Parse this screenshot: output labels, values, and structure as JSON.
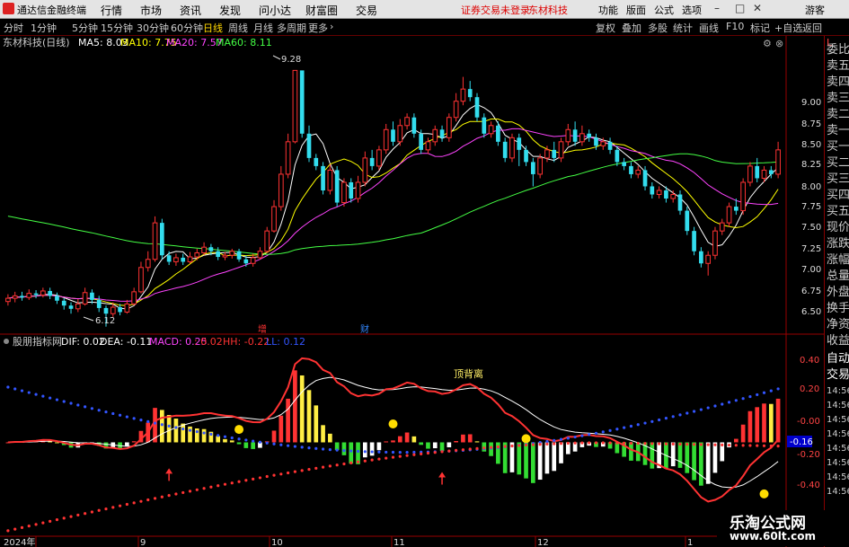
{
  "menubar": {
    "title": "通达信金融终端",
    "menus": [
      "行情",
      "市场",
      "资讯",
      "发现",
      "问小达",
      "财富圈",
      "交易"
    ],
    "notice": "证券交易未登录",
    "stock": "东材科技",
    "right": [
      "功能",
      "版面",
      "公式",
      "选项"
    ],
    "user": "游客"
  },
  "toolbar": {
    "periods": [
      "分时",
      "1分钟",
      "5分钟",
      "15分钟",
      "30分钟",
      "60分钟",
      "日线",
      "周线",
      "月线",
      "多周期",
      "更多"
    ],
    "active": "日线",
    "right": [
      "复权",
      "叠加",
      "多股",
      "统计",
      "画线",
      "F10",
      "标记",
      "+自选",
      "返回"
    ]
  },
  "price_panel": {
    "title": "东材科技(日线)",
    "ma_labels": [
      {
        "label": "MA5: 8.03",
        "color": "#ffffff"
      },
      {
        "label": "MA10: 7.75",
        "color": "#ffff00"
      },
      {
        "label": "MA20: 7.57",
        "color": "#ff44ff"
      },
      {
        "label": "MA60: 8.11",
        "color": "#44ff44"
      }
    ],
    "high_label": "9.28",
    "low_label": "6.12",
    "marks": [
      "增",
      "财"
    ]
  },
  "indicator_panel": {
    "title": "股朋指标网",
    "items": [
      {
        "label": "DIF: 0.02",
        "color": "#ffffff"
      },
      {
        "label": "DEA: -0.11",
        "color": "#ffffff"
      },
      {
        "label": "MACD: 0.25",
        "color": "#ff44ff"
      },
      {
        "label": ": 0.02",
        "color": "#ff3333"
      },
      {
        "label": "HH: -0.22",
        "color": "#ff3333"
      },
      {
        "label": "LL: 0.12",
        "color": "#3355ff"
      }
    ],
    "annotation": "顶背离",
    "current_value": "-0.16"
  },
  "x_axis": [
    "2024年",
    "9",
    "10",
    "11",
    "12",
    "1"
  ],
  "side_panel": {
    "label": "L",
    "items": [
      "委比",
      "卖五",
      "卖四",
      "卖三",
      "卖二",
      "卖一",
      "买一",
      "买二",
      "买三",
      "买四",
      "买五",
      "现价",
      "涨跌",
      "涨幅",
      "总量",
      "外盘",
      "换手",
      "净资",
      "收益",
      "自动",
      "交易"
    ],
    "ticks": [
      "14:56",
      "14:56",
      "14:56",
      "14:56",
      "14:56",
      "14:56",
      "14:56",
      "14:56"
    ]
  },
  "price_axis": [
    "9.00",
    "8.75",
    "8.50",
    "8.25",
    "8.00",
    "7.75",
    "7.50",
    "7.25",
    "7.00",
    "6.75",
    "6.50"
  ],
  "indicator_axis": [
    "0.40",
    "0.20",
    "-0.00",
    "-0.20",
    "-0.40"
  ],
  "watermark": {
    "line1": "乐淘公式网",
    "line2": "www.60lt.com"
  },
  "chart_data": {
    "type": "candlestick",
    "title": "东材科技(日线)",
    "candles": [
      [
        6.43,
        6.47,
        6.38,
        6.52
      ],
      [
        6.47,
        6.5,
        6.42,
        6.55
      ],
      [
        6.5,
        6.48,
        6.44,
        6.55
      ],
      [
        6.48,
        6.53,
        6.45,
        6.58
      ],
      [
        6.53,
        6.51,
        6.47,
        6.57
      ],
      [
        6.51,
        6.56,
        6.48,
        6.6
      ],
      [
        6.56,
        6.5,
        6.46,
        6.6
      ],
      [
        6.5,
        6.44,
        6.4,
        6.54
      ],
      [
        6.44,
        6.38,
        6.33,
        6.47
      ],
      [
        6.38,
        6.34,
        6.28,
        6.42
      ],
      [
        6.34,
        6.4,
        6.3,
        6.46
      ],
      [
        6.4,
        6.54,
        6.38,
        6.6
      ],
      [
        6.54,
        6.45,
        6.4,
        6.58
      ],
      [
        6.45,
        6.35,
        6.3,
        6.5
      ],
      [
        6.35,
        6.28,
        6.12,
        6.38
      ],
      [
        6.28,
        6.36,
        6.24,
        6.42
      ],
      [
        6.36,
        6.3,
        6.26,
        6.4
      ],
      [
        6.3,
        6.4,
        6.28,
        6.45
      ],
      [
        6.4,
        6.55,
        6.38,
        6.6
      ],
      [
        6.55,
        6.85,
        6.53,
        6.92
      ],
      [
        6.85,
        6.95,
        6.8,
        7.05
      ],
      [
        6.95,
        7.4,
        6.92,
        7.48
      ],
      [
        7.4,
        7.0,
        6.95,
        7.45
      ],
      [
        7.0,
        6.92,
        6.88,
        7.05
      ],
      [
        6.92,
        6.97,
        6.87,
        7.02
      ],
      [
        6.97,
        6.92,
        6.88,
        7.02
      ],
      [
        6.92,
        6.98,
        6.9,
        7.04
      ],
      [
        6.98,
        7.03,
        6.94,
        7.08
      ],
      [
        7.03,
        7.1,
        7.0,
        7.16
      ],
      [
        7.1,
        7.05,
        7.0,
        7.14
      ],
      [
        7.05,
        6.98,
        6.94,
        7.1
      ],
      [
        6.98,
        7.0,
        6.94,
        7.04
      ],
      [
        7.0,
        7.05,
        6.96,
        7.08
      ],
      [
        7.05,
        6.95,
        6.92,
        7.08
      ],
      [
        6.95,
        6.9,
        6.86,
        7.0
      ],
      [
        6.9,
        6.97,
        6.86,
        7.02
      ],
      [
        6.97,
        7.05,
        6.95,
        7.1
      ],
      [
        7.05,
        7.3,
        7.03,
        7.35
      ],
      [
        7.3,
        7.6,
        7.28,
        7.68
      ],
      [
        7.6,
        8.0,
        7.55,
        8.1
      ],
      [
        8.0,
        8.4,
        7.95,
        8.5
      ],
      [
        8.4,
        9.28,
        8.38,
        9.28
      ],
      [
        9.28,
        8.5,
        8.45,
        9.25
      ],
      [
        8.5,
        8.2,
        8.15,
        8.6
      ],
      [
        8.2,
        8.1,
        8.05,
        8.25
      ],
      [
        8.1,
        7.8,
        7.75,
        8.15
      ],
      [
        7.8,
        8.05,
        7.75,
        8.12
      ],
      [
        8.05,
        7.65,
        7.6,
        8.1
      ],
      [
        7.65,
        7.9,
        7.6,
        7.95
      ],
      [
        7.9,
        7.7,
        7.65,
        7.95
      ],
      [
        7.7,
        7.9,
        7.65,
        7.98
      ],
      [
        7.9,
        8.2,
        7.85,
        8.28
      ],
      [
        8.2,
        8.1,
        8.05,
        8.3
      ],
      [
        8.1,
        8.3,
        8.05,
        8.35
      ],
      [
        8.3,
        8.55,
        8.25,
        8.62
      ],
      [
        8.55,
        8.4,
        8.35,
        8.65
      ],
      [
        8.4,
        8.6,
        8.35,
        8.68
      ],
      [
        8.6,
        8.7,
        8.55,
        8.75
      ],
      [
        8.7,
        8.5,
        8.45,
        8.75
      ],
      [
        8.5,
        8.3,
        8.25,
        8.55
      ],
      [
        8.3,
        8.4,
        8.25,
        8.45
      ],
      [
        8.4,
        8.55,
        8.35,
        8.6
      ],
      [
        8.55,
        8.45,
        8.4,
        8.6
      ],
      [
        8.45,
        8.7,
        8.4,
        8.75
      ],
      [
        8.7,
        8.9,
        8.65,
        9.0
      ],
      [
        8.9,
        9.05,
        8.85,
        9.2
      ],
      [
        9.05,
        8.95,
        8.9,
        9.15
      ],
      [
        8.95,
        8.7,
        8.65,
        9.0
      ],
      [
        8.7,
        8.5,
        8.45,
        8.75
      ],
      [
        8.5,
        8.6,
        8.45,
        8.65
      ],
      [
        8.6,
        8.4,
        8.35,
        8.65
      ],
      [
        8.4,
        8.2,
        8.15,
        8.45
      ],
      [
        8.2,
        8.45,
        8.15,
        8.5
      ],
      [
        8.45,
        8.3,
        8.1,
        8.5
      ],
      [
        8.3,
        8.15,
        8.1,
        8.35
      ],
      [
        8.15,
        8.0,
        7.85,
        8.2
      ],
      [
        8.0,
        8.2,
        7.95,
        8.25
      ],
      [
        8.2,
        8.3,
        8.15,
        8.35
      ],
      [
        8.3,
        8.2,
        8.15,
        8.4
      ],
      [
        8.2,
        8.4,
        8.15,
        8.45
      ],
      [
        8.4,
        8.55,
        8.35,
        8.62
      ],
      [
        8.55,
        8.4,
        8.35,
        8.65
      ],
      [
        8.4,
        8.5,
        8.35,
        8.6
      ],
      [
        8.5,
        8.45,
        8.4,
        8.55
      ],
      [
        8.45,
        8.35,
        8.3,
        8.5
      ],
      [
        8.35,
        8.4,
        8.3,
        8.45
      ],
      [
        8.4,
        8.3,
        8.25,
        8.45
      ],
      [
        8.3,
        8.15,
        8.1,
        8.35
      ],
      [
        8.15,
        8.1,
        8.05,
        8.2
      ],
      [
        8.1,
        8.0,
        7.95,
        8.15
      ],
      [
        8.0,
        8.05,
        7.95,
        8.1
      ],
      [
        8.05,
        7.85,
        7.8,
        8.1
      ],
      [
        7.85,
        7.75,
        7.7,
        7.9
      ],
      [
        7.75,
        7.8,
        7.7,
        7.85
      ],
      [
        7.8,
        7.7,
        7.65,
        7.85
      ],
      [
        7.7,
        7.75,
        7.65,
        7.8
      ],
      [
        7.75,
        7.55,
        7.5,
        7.8
      ],
      [
        7.55,
        7.3,
        7.25,
        7.6
      ],
      [
        7.3,
        7.05,
        7.0,
        7.35
      ],
      [
        7.05,
        6.9,
        6.85,
        7.1
      ],
      [
        6.9,
        7.0,
        6.75,
        7.05
      ],
      [
        7.0,
        7.3,
        6.95,
        7.35
      ],
      [
        7.3,
        7.4,
        7.25,
        7.45
      ],
      [
        7.4,
        7.6,
        7.35,
        7.65
      ],
      [
        7.6,
        7.55,
        7.5,
        7.7
      ],
      [
        7.55,
        7.9,
        7.5,
        7.95
      ],
      [
        7.9,
        8.1,
        7.85,
        8.15
      ],
      [
        8.1,
        7.95,
        7.9,
        8.2
      ],
      [
        7.95,
        8.05,
        7.9,
        8.1
      ],
      [
        8.05,
        8.0,
        7.95,
        8.1
      ],
      [
        8.0,
        8.3,
        7.95,
        8.4
      ]
    ],
    "ma_series": [
      {
        "name": "MA5",
        "color": "#ffffff",
        "period": 5
      },
      {
        "name": "MA10",
        "color": "#ffff00",
        "period": 10
      },
      {
        "name": "MA20",
        "color": "#ff44ff",
        "period": 20
      },
      {
        "name": "MA60",
        "color": "#44ff44",
        "period": 60,
        "seed": 7.5
      }
    ],
    "ylim": [
      6.05,
      9.55
    ],
    "indicator": {
      "ylim": [
        -0.5,
        0.5
      ]
    }
  }
}
